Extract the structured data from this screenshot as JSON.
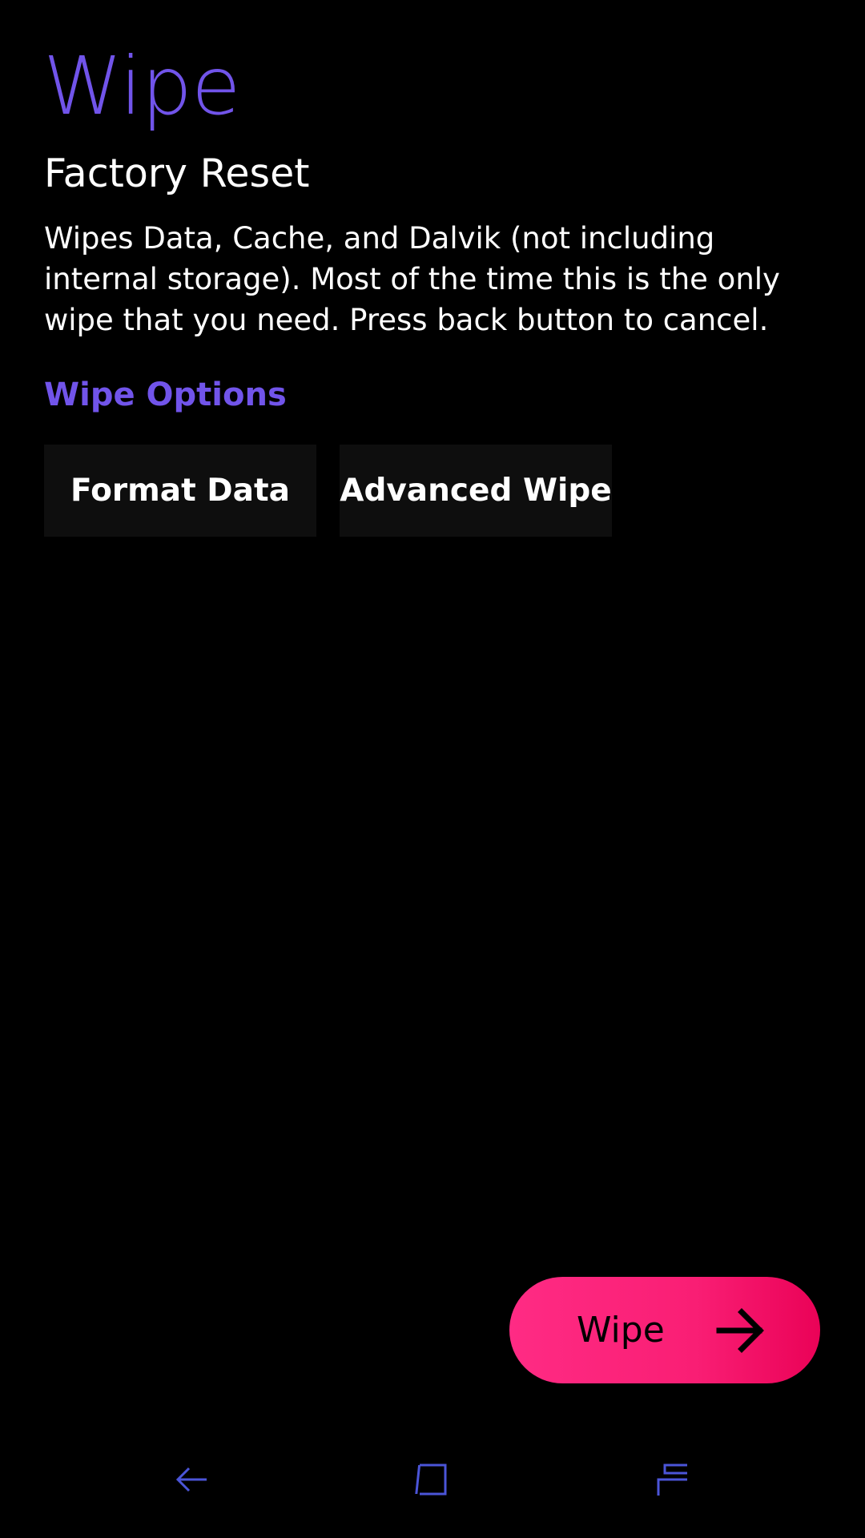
{
  "header": {
    "title": "Wipe"
  },
  "factory_reset": {
    "title": "Factory Reset",
    "description": "Wipes Data, Cache, and Dalvik (not including internal storage). Most of the time this is the only wipe that you need. Press back button to cancel."
  },
  "wipe_options": {
    "heading": "Wipe Options",
    "buttons": [
      {
        "label": "Format Data"
      },
      {
        "label": "Advanced Wipe"
      }
    ]
  },
  "action": {
    "label": "Wipe",
    "icon": "arrow-right-icon"
  },
  "navbar": {
    "icons": [
      "back-icon",
      "home-icon",
      "recent-apps-icon"
    ]
  },
  "colors": {
    "background": "#000000",
    "accent": "#7154ea",
    "action_gradient_start": "#ff2b84",
    "action_gradient_end": "#ea0257",
    "button_bg": "#0e0e0e",
    "nav_icon": "#4b55d8"
  }
}
